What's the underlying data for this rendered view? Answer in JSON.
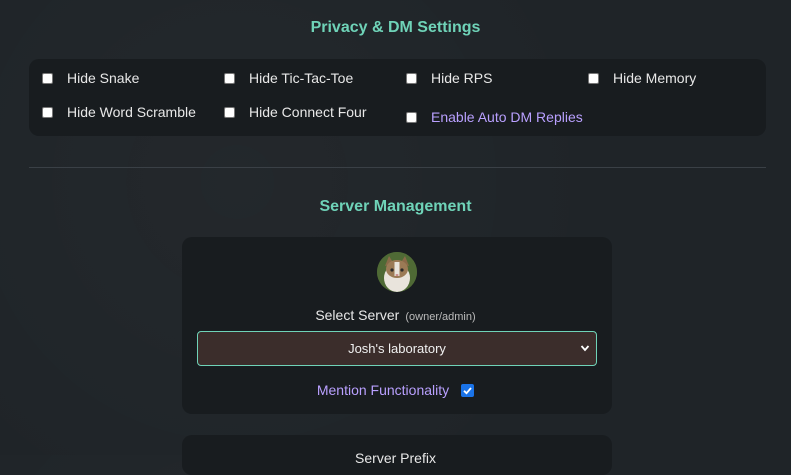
{
  "privacy": {
    "title": "Privacy & DM Settings",
    "options": [
      {
        "label": "Hide Snake",
        "checked": false
      },
      {
        "label": "Hide Tic-Tac-Toe",
        "checked": false
      },
      {
        "label": "Hide RPS",
        "checked": false
      },
      {
        "label": "Hide Memory",
        "checked": false
      },
      {
        "label": "Hide Word Scramble",
        "checked": false
      },
      {
        "label": "Hide Connect Four",
        "checked": false
      },
      {
        "label": "Enable Auto DM Replies",
        "checked": false
      }
    ]
  },
  "server": {
    "title": "Server Management",
    "select_label": "Select Server",
    "select_hint": "(owner/admin)",
    "selected_server": "Josh's laboratory",
    "mention_label": "Mention Functionality",
    "mention_checked": true,
    "next_section_label": "Server Prefix"
  },
  "colors": {
    "accent": "#6fd3b8",
    "purple_label": "#b9a0ff",
    "panel": "#181c1f",
    "background": "#1f2428"
  }
}
